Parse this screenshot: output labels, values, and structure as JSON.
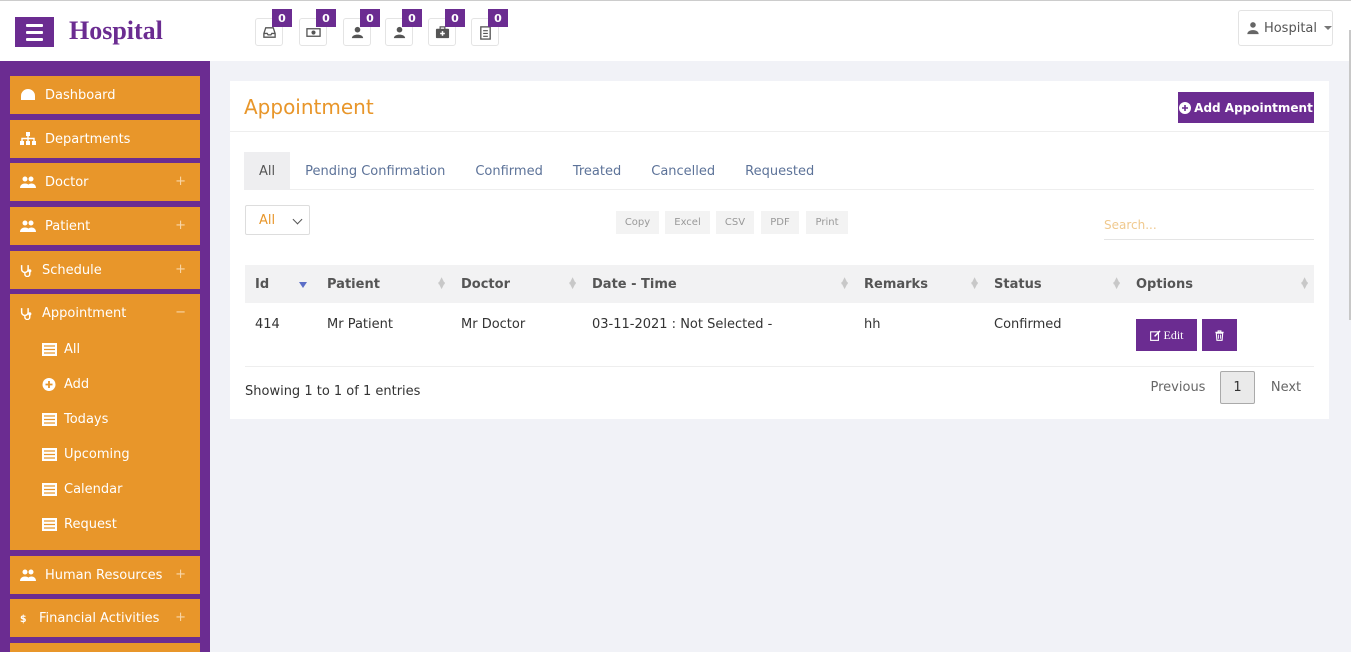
{
  "header": {
    "brand": "Hospital",
    "user_menu_label": "Hospital",
    "notifications": [
      {
        "icon": "inbox-icon",
        "count": "0"
      },
      {
        "icon": "money-icon",
        "count": "0"
      },
      {
        "icon": "user-icon",
        "count": "0"
      },
      {
        "icon": "user-icon",
        "count": "0"
      },
      {
        "icon": "medkit-icon",
        "count": "0"
      },
      {
        "icon": "clipboard-icon",
        "count": "0"
      }
    ]
  },
  "sidebar": {
    "items": [
      {
        "label": "Dashboard",
        "icon": "dashboard-icon"
      },
      {
        "label": "Departments",
        "icon": "sitemap-icon"
      },
      {
        "label": "Doctor",
        "icon": "users-icon",
        "toggle": "+"
      },
      {
        "label": "Patient",
        "icon": "users-icon",
        "toggle": "+"
      },
      {
        "label": "Schedule",
        "icon": "stethoscope-icon",
        "toggle": "+"
      },
      {
        "label": "Appointment",
        "icon": "stethoscope-icon",
        "toggle": "−"
      },
      {
        "label": "Human Resources",
        "icon": "users-icon",
        "toggle": "+"
      },
      {
        "label": "Financial Activities",
        "icon": "dollar-icon",
        "toggle": "+"
      }
    ],
    "appointment_sub": [
      {
        "label": "All",
        "icon": "list-icon"
      },
      {
        "label": "Add",
        "icon": "plus-circle-icon"
      },
      {
        "label": "Todays",
        "icon": "list-icon"
      },
      {
        "label": "Upcoming",
        "icon": "list-icon"
      },
      {
        "label": "Calendar",
        "icon": "list-icon"
      },
      {
        "label": "Request",
        "icon": "list-icon"
      }
    ]
  },
  "panel": {
    "title": "Appointment",
    "add_button": "Add Appointment",
    "tabs": [
      "All",
      "Pending Confirmation",
      "Confirmed",
      "Treated",
      "Cancelled",
      "Requested"
    ],
    "active_tab": "All",
    "length_value": "All",
    "export_buttons": [
      "Copy",
      "Excel",
      "CSV",
      "PDF",
      "Print"
    ],
    "search_placeholder": "Search...",
    "columns": [
      "Id",
      "Patient",
      "Doctor",
      "Date - Time",
      "Remarks",
      "Status",
      "Options"
    ],
    "rows": [
      {
        "id": "414",
        "patient": "Mr Patient",
        "doctor": "Mr Doctor",
        "datetime": "03-11-2021 : Not Selected -",
        "remarks": "hh",
        "status": "Confirmed"
      }
    ],
    "edit_label": "Edit",
    "info": "Showing 1 to 1 of 1 entries",
    "pagination": {
      "previous": "Previous",
      "current": "1",
      "next": "Next"
    }
  },
  "colors": {
    "brand": "#6b2c91",
    "accent": "#e8962a"
  }
}
